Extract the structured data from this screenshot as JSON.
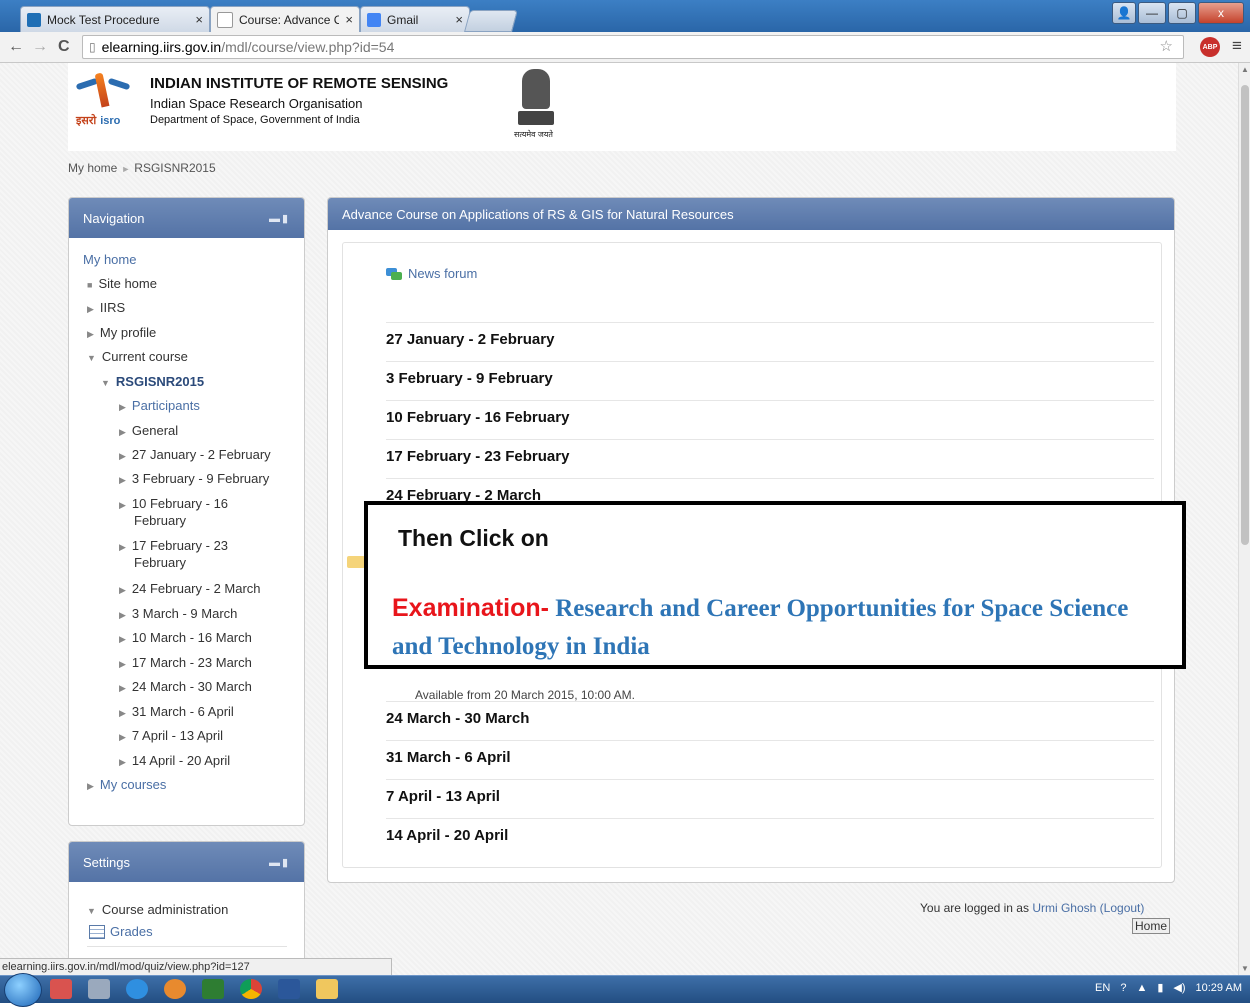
{
  "browser": {
    "tabs": [
      {
        "label": "Mock Test Procedure",
        "close": "×"
      },
      {
        "label": "Course: Advance Course o",
        "close": "×"
      },
      {
        "label": "Gmail",
        "close": "×"
      }
    ],
    "url_host": "elearning.iirs.gov.in",
    "url_path": "/mdl/course/view.php?id=54",
    "back": "←",
    "forward": "→",
    "reload": "C",
    "star": "☆",
    "abp": "ABP",
    "menu": "≡",
    "window_minimize": "—",
    "window_maximize": "▢",
    "window_close": "x"
  },
  "header": {
    "title": "INDIAN INSTITUTE OF REMOTE SENSING",
    "subtitle": "Indian Space Research Organisation",
    "subtitle2": "Department of Space, Government of India",
    "isro_hindi": "इसरो",
    "isro_english": "isro",
    "emblem_motto": "सत्यमेव जयते"
  },
  "breadcrumb": {
    "home": "My home",
    "sep": "►",
    "course": "RSGISNR2015"
  },
  "navigation": {
    "title": "Navigation",
    "items": [
      {
        "label": "My home",
        "tri": ""
      },
      {
        "label": "Site home",
        "tri": "■"
      },
      {
        "label": "IIRS",
        "tri": "▶"
      },
      {
        "label": "My profile",
        "tri": "▶"
      },
      {
        "label": "Current course",
        "tri": "▼"
      },
      {
        "label": "RSGISNR2015",
        "tri": "▼"
      },
      {
        "label": "Participants",
        "tri": "▶"
      },
      {
        "label": "General",
        "tri": "▶"
      },
      {
        "label": "27 January - 2 February",
        "tri": "▶"
      },
      {
        "label": "3 February - 9 February",
        "tri": "▶"
      },
      {
        "label": "10 February - 16",
        "label2": "February",
        "tri": "▶"
      },
      {
        "label": "17 February - 23",
        "label2": "February",
        "tri": "▶"
      },
      {
        "label": "24 February - 2 March",
        "tri": "▶"
      },
      {
        "label": "3 March - 9 March",
        "tri": "▶"
      },
      {
        "label": "10 March - 16 March",
        "tri": "▶"
      },
      {
        "label": "17 March - 23 March",
        "tri": "▶"
      },
      {
        "label": "24 March - 30 March",
        "tri": "▶"
      },
      {
        "label": "31 March - 6 April",
        "tri": "▶"
      },
      {
        "label": "7 April - 13 April",
        "tri": "▶"
      },
      {
        "label": "14 April - 20 April",
        "tri": "▶"
      },
      {
        "label": "My courses",
        "tri": "▶"
      }
    ]
  },
  "settings": {
    "title": "Settings",
    "course_admin": "Course administration",
    "grades": "Grades",
    "tri": "▼"
  },
  "main": {
    "title": "Advance Course on Applications of RS & GIS for Natural Resources",
    "news_forum": "News forum",
    "sections": [
      "27 January - 2 February",
      "3 February - 9 February",
      "10 February - 16 February",
      "17 February - 23 February",
      "24 February - 2 March",
      "24 March - 30 March",
      "31 March - 6 April",
      "7 April - 13 April",
      "14 April - 20 April"
    ],
    "available": "Available from 20 March 2015, 10:00 AM."
  },
  "callout": {
    "title": "Then Click on",
    "exam_label": "Examination-",
    "exam_title": " Research and Career Opportunities for Space Science and Technology in India"
  },
  "footer": {
    "logged_prefix": "You are logged in as ",
    "user": "Urmi Ghosh",
    "logout": "(Logout)",
    "home": "Home"
  },
  "statusbar": "elearning.iirs.gov.in/mdl/mod/quiz/view.php?id=127",
  "taskbar": {
    "lang": "EN",
    "time": "10:29 AM"
  }
}
